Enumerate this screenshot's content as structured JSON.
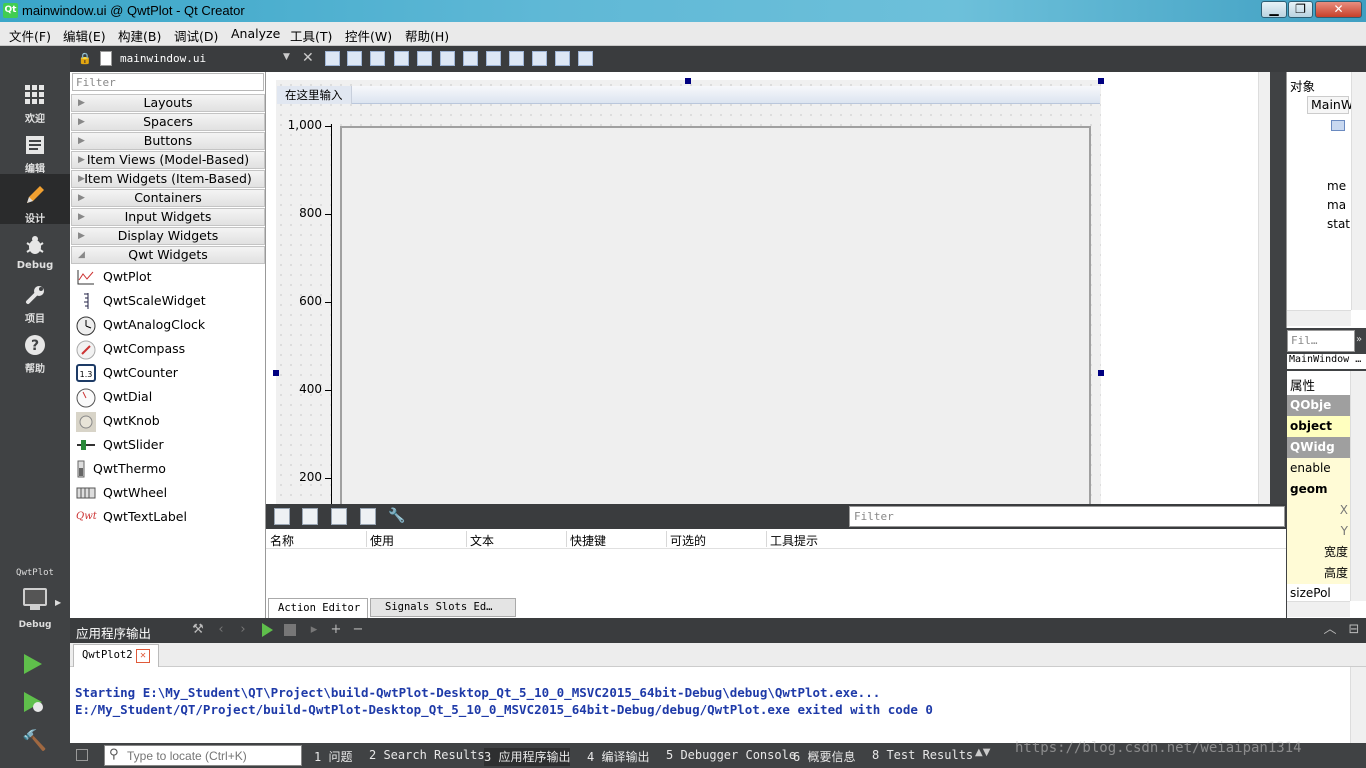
{
  "window": {
    "title": "mainwindow.ui @ QwtPlot - Qt Creator",
    "app_icon_text": "Qt",
    "buttons": {
      "minimize": "▁",
      "maximize": "❐",
      "close": "✕"
    }
  },
  "menubar": [
    "文件(F)",
    "编辑(E)",
    "构建(B)",
    "调试(D)",
    "Analyze",
    "工具(T)",
    "控件(W)",
    "帮助(H)"
  ],
  "modes": [
    {
      "label": "欢迎",
      "icon": "grid-icon"
    },
    {
      "label": "编辑",
      "icon": "document-icon"
    },
    {
      "label": "设计",
      "icon": "pencil-icon",
      "active": true
    },
    {
      "label": "Debug",
      "icon": "bug-icon"
    },
    {
      "label": "项目",
      "icon": "wrench-icon"
    },
    {
      "label": "帮助",
      "icon": "help-icon"
    }
  ],
  "kit": {
    "project": "QwtPlot",
    "config": "Debug"
  },
  "designer": {
    "file_name": "mainwindow.ui"
  },
  "widget_box": {
    "filter_placeholder": "Filter",
    "categories": [
      "Layouts",
      "Spacers",
      "Buttons",
      "Item Views (Model-Based)",
      "Item Widgets (Item-Based)",
      "Containers",
      "Input Widgets",
      "Display Widgets",
      "Qwt Widgets"
    ],
    "qwt_widgets": [
      "QwtPlot",
      "QwtScaleWidget",
      "QwtAnalogClock",
      "QwtCompass",
      "QwtCounter",
      "QwtDial",
      "QwtKnob",
      "QwtSlider",
      "QwtThermo",
      "QwtWheel",
      "QwtTextLabel"
    ],
    "text_label_icon_text": "Qwt",
    "counter_icon_text": "1.3"
  },
  "form": {
    "menu_placeholder": "在这里输入",
    "y_ticks": [
      "1,000",
      "800",
      "600",
      "400",
      "200"
    ]
  },
  "action_editor": {
    "filter_placeholder": "Filter",
    "columns": [
      "名称",
      "使用",
      "文本",
      "快捷键",
      "可选的",
      "工具提示"
    ],
    "tabs": [
      "Action Editor",
      "Signals  Slots Ed…"
    ]
  },
  "object_inspector": {
    "title": "对象",
    "root": "MainW",
    "children": [
      "me",
      "ma",
      "stat"
    ]
  },
  "property_editor": {
    "filter_placeholder": "Fil…",
    "class_label": "MainWindow …",
    "title": "属性",
    "rows": [
      "QObje",
      "object",
      "QWidg",
      "enable",
      "geom",
      "X",
      "Y",
      "宽度",
      "高度",
      "sizePol"
    ]
  },
  "output": {
    "pane_title": "应用程序输出",
    "tab_label": "QwtPlot2",
    "lines": [
      "Starting E:\\My_Student\\QT\\Project\\build-QwtPlot-Desktop_Qt_5_10_0_MSVC2015_64bit-Debug\\debug\\QwtPlot.exe...",
      "E:/My_Student/QT/Project/build-QwtPlot-Desktop_Qt_5_10_0_MSVC2015_64bit-Debug/debug/QwtPlot.exe exited with code 0"
    ]
  },
  "statusbar": {
    "locator_placeholder": "Type to locate (Ctrl+K)",
    "tabs": [
      "1 问题",
      "2 Search Results",
      "3 应用程序输出",
      "4 编译输出",
      "5 Debugger Console",
      "6 概要信息",
      "8 Test Results"
    ]
  },
  "watermark": "https://blog.csdn.net/weiaipan1314"
}
